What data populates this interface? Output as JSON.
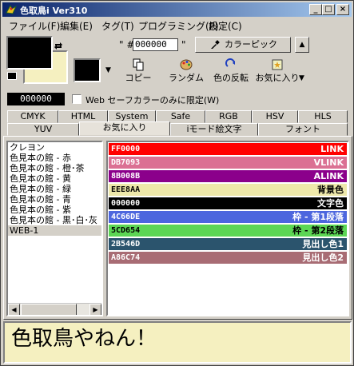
{
  "window": {
    "title": "色取鳥i Ver310"
  },
  "titlebar": {
    "minimize": "_",
    "maximize": "□",
    "close": "×"
  },
  "menu": [
    "ファイル(F)",
    "編集(E)",
    "タグ(T)",
    "プログラミング(P)",
    "設定(C)"
  ],
  "colors": {
    "foreground": "#000000",
    "background": "#f5f0c0",
    "small_swatch": "#000000",
    "accent_title": "#0a246a"
  },
  "hex_prefix": "\" #",
  "hex_suffix": "\"",
  "hex_value": "000000",
  "picker_button": "カラーピック",
  "toolbar": [
    {
      "label": "コピー",
      "icon": "copy-icon"
    },
    {
      "label": "ランダム",
      "icon": "palette-icon"
    },
    {
      "label": "色の反転",
      "icon": "invert-icon"
    },
    {
      "label": "お気に入り",
      "icon": "favorite-icon"
    }
  ],
  "current_hex": "000000",
  "websafe_label": "Web セーフカラーのみに限定(W)",
  "tabs_row1": [
    "CMYK",
    "HTML",
    "System",
    "Safe",
    "RGB",
    "HSV",
    "HLS"
  ],
  "tabs_row2": [
    "YUV",
    "お気に入り",
    "iモード絵文字",
    "フォント"
  ],
  "active_tab": "お気に入り",
  "favorites_list": [
    "クレヨン",
    "色見本の館 - 赤",
    "色見本の館 - 橙･茶",
    "色見本の館 - 黄",
    "色見本の館 - 緑",
    "色見本の館 - 青",
    "色見本の館 - 紫",
    "色見本の館 - 黒･白･灰",
    "WEB-1"
  ],
  "selected_favorite": "WEB-1",
  "color_entries": [
    {
      "hex": "FF0000",
      "name": "LINK",
      "bg": "#ff0000",
      "fg": "#ffffff"
    },
    {
      "hex": "DB7093",
      "name": "VLINK",
      "bg": "#db7093",
      "fg": "#ffffff"
    },
    {
      "hex": "8B008B",
      "name": "ALINK",
      "bg": "#8b008b",
      "fg": "#ffffff"
    },
    {
      "hex": "EEE8AA",
      "name": "背景色",
      "bg": "#eee8aa",
      "fg": "#000000"
    },
    {
      "hex": "000000",
      "name": "文字色",
      "bg": "#000000",
      "fg": "#ffffff"
    },
    {
      "hex": "4C66DE",
      "name": "枠 - 第1段落",
      "bg": "#4c66de",
      "fg": "#ffffff"
    },
    {
      "hex": "5CD654",
      "name": "枠 - 第2段落",
      "bg": "#5cd654",
      "fg": "#000000"
    },
    {
      "hex": "2B546D",
      "name": "見出し色1",
      "bg": "#2b546d",
      "fg": "#ffffff"
    },
    {
      "hex": "A86C74",
      "name": "見出し色2",
      "bg": "#a86c74",
      "fg": "#ffffff"
    }
  ],
  "preview_text": "色取鳥やねん！"
}
